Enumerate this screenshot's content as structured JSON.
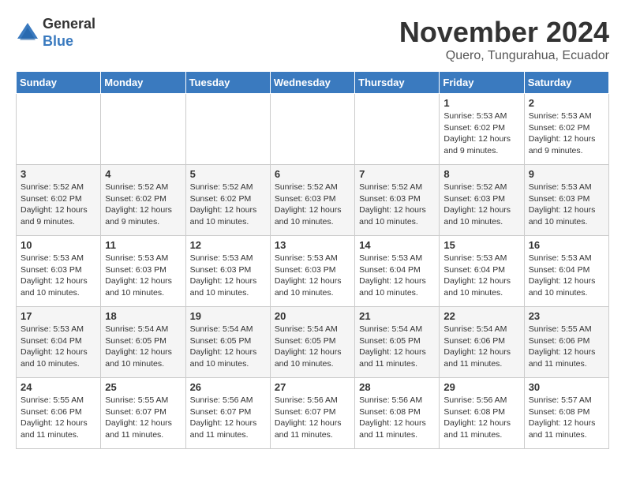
{
  "logo": {
    "general": "General",
    "blue": "Blue"
  },
  "title": "November 2024",
  "location": "Quero, Tungurahua, Ecuador",
  "days_header": [
    "Sunday",
    "Monday",
    "Tuesday",
    "Wednesday",
    "Thursday",
    "Friday",
    "Saturday"
  ],
  "weeks": [
    [
      {
        "day": "",
        "info": ""
      },
      {
        "day": "",
        "info": ""
      },
      {
        "day": "",
        "info": ""
      },
      {
        "day": "",
        "info": ""
      },
      {
        "day": "",
        "info": ""
      },
      {
        "day": "1",
        "info": "Sunrise: 5:53 AM\nSunset: 6:02 PM\nDaylight: 12 hours and 9 minutes."
      },
      {
        "day": "2",
        "info": "Sunrise: 5:53 AM\nSunset: 6:02 PM\nDaylight: 12 hours and 9 minutes."
      }
    ],
    [
      {
        "day": "3",
        "info": "Sunrise: 5:52 AM\nSunset: 6:02 PM\nDaylight: 12 hours and 9 minutes."
      },
      {
        "day": "4",
        "info": "Sunrise: 5:52 AM\nSunset: 6:02 PM\nDaylight: 12 hours and 9 minutes."
      },
      {
        "day": "5",
        "info": "Sunrise: 5:52 AM\nSunset: 6:02 PM\nDaylight: 12 hours and 10 minutes."
      },
      {
        "day": "6",
        "info": "Sunrise: 5:52 AM\nSunset: 6:03 PM\nDaylight: 12 hours and 10 minutes."
      },
      {
        "day": "7",
        "info": "Sunrise: 5:52 AM\nSunset: 6:03 PM\nDaylight: 12 hours and 10 minutes."
      },
      {
        "day": "8",
        "info": "Sunrise: 5:52 AM\nSunset: 6:03 PM\nDaylight: 12 hours and 10 minutes."
      },
      {
        "day": "9",
        "info": "Sunrise: 5:53 AM\nSunset: 6:03 PM\nDaylight: 12 hours and 10 minutes."
      }
    ],
    [
      {
        "day": "10",
        "info": "Sunrise: 5:53 AM\nSunset: 6:03 PM\nDaylight: 12 hours and 10 minutes."
      },
      {
        "day": "11",
        "info": "Sunrise: 5:53 AM\nSunset: 6:03 PM\nDaylight: 12 hours and 10 minutes."
      },
      {
        "day": "12",
        "info": "Sunrise: 5:53 AM\nSunset: 6:03 PM\nDaylight: 12 hours and 10 minutes."
      },
      {
        "day": "13",
        "info": "Sunrise: 5:53 AM\nSunset: 6:03 PM\nDaylight: 12 hours and 10 minutes."
      },
      {
        "day": "14",
        "info": "Sunrise: 5:53 AM\nSunset: 6:04 PM\nDaylight: 12 hours and 10 minutes."
      },
      {
        "day": "15",
        "info": "Sunrise: 5:53 AM\nSunset: 6:04 PM\nDaylight: 12 hours and 10 minutes."
      },
      {
        "day": "16",
        "info": "Sunrise: 5:53 AM\nSunset: 6:04 PM\nDaylight: 12 hours and 10 minutes."
      }
    ],
    [
      {
        "day": "17",
        "info": "Sunrise: 5:53 AM\nSunset: 6:04 PM\nDaylight: 12 hours and 10 minutes."
      },
      {
        "day": "18",
        "info": "Sunrise: 5:54 AM\nSunset: 6:05 PM\nDaylight: 12 hours and 10 minutes."
      },
      {
        "day": "19",
        "info": "Sunrise: 5:54 AM\nSunset: 6:05 PM\nDaylight: 12 hours and 10 minutes."
      },
      {
        "day": "20",
        "info": "Sunrise: 5:54 AM\nSunset: 6:05 PM\nDaylight: 12 hours and 10 minutes."
      },
      {
        "day": "21",
        "info": "Sunrise: 5:54 AM\nSunset: 6:05 PM\nDaylight: 12 hours and 11 minutes."
      },
      {
        "day": "22",
        "info": "Sunrise: 5:54 AM\nSunset: 6:06 PM\nDaylight: 12 hours and 11 minutes."
      },
      {
        "day": "23",
        "info": "Sunrise: 5:55 AM\nSunset: 6:06 PM\nDaylight: 12 hours and 11 minutes."
      }
    ],
    [
      {
        "day": "24",
        "info": "Sunrise: 5:55 AM\nSunset: 6:06 PM\nDaylight: 12 hours and 11 minutes."
      },
      {
        "day": "25",
        "info": "Sunrise: 5:55 AM\nSunset: 6:07 PM\nDaylight: 12 hours and 11 minutes."
      },
      {
        "day": "26",
        "info": "Sunrise: 5:56 AM\nSunset: 6:07 PM\nDaylight: 12 hours and 11 minutes."
      },
      {
        "day": "27",
        "info": "Sunrise: 5:56 AM\nSunset: 6:07 PM\nDaylight: 12 hours and 11 minutes."
      },
      {
        "day": "28",
        "info": "Sunrise: 5:56 AM\nSunset: 6:08 PM\nDaylight: 12 hours and 11 minutes."
      },
      {
        "day": "29",
        "info": "Sunrise: 5:56 AM\nSunset: 6:08 PM\nDaylight: 12 hours and 11 minutes."
      },
      {
        "day": "30",
        "info": "Sunrise: 5:57 AM\nSunset: 6:08 PM\nDaylight: 12 hours and 11 minutes."
      }
    ]
  ]
}
